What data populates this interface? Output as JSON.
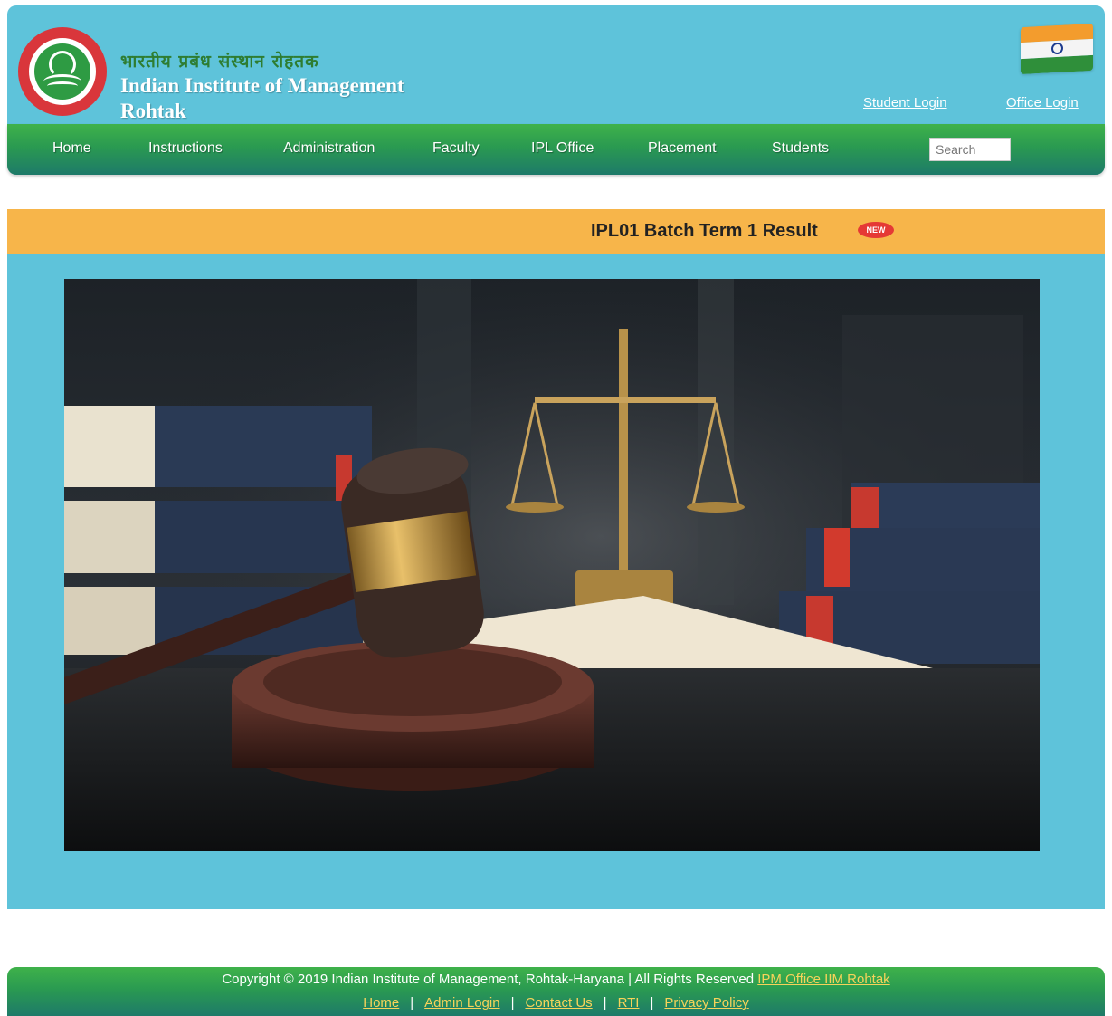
{
  "header": {
    "hindi_name": "भारतीय प्रबंध संस्थान रोहतक",
    "institute_name_line1": "Indian Institute of Management",
    "institute_name_line2": "Rohtak",
    "student_login": "Student Login",
    "office_login": "Office Login"
  },
  "nav": {
    "items": [
      "Home",
      "Instructions",
      "Administration",
      "Faculty",
      "IPL Office",
      "Placement",
      "Students"
    ],
    "search_placeholder": "Search"
  },
  "banner": {
    "text": "IPL01 Batch Term 1 Result",
    "badge": "NEW"
  },
  "footer": {
    "copyright": "Copyright © 2019  Indian Institute of Management, Rohtak-Haryana | All Rights Reserved ",
    "office_link": "IPM Office IIM Rohtak",
    "links": [
      "Home",
      "Admin Login",
      "Contact Us",
      "RTI",
      "Privacy Policy"
    ]
  },
  "colors": {
    "header_bg": "#5ec3da",
    "nav_green": "#2a9a51",
    "banner_orange": "#f7b54a",
    "link_yellow": "#f7d35a"
  }
}
